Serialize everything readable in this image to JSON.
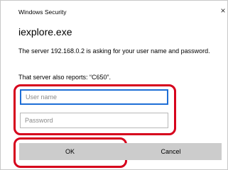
{
  "window": {
    "title": "Windows Security",
    "close_glyph": "×"
  },
  "app_name": "iexplore.exe",
  "message": "The server 192.168.0.2 is asking for your user name and password.",
  "server_report": "That server also reports: “C650”.",
  "fields": {
    "username_placeholder": "User name",
    "password_placeholder": "Password"
  },
  "buttons": {
    "ok_label": "OK",
    "cancel_label": "Cancel"
  },
  "colors": {
    "highlight": "#d6001c",
    "focus_border": "#1e6ed6",
    "button_bg": "#cccccc"
  },
  "icons": {
    "close": "close-icon"
  }
}
